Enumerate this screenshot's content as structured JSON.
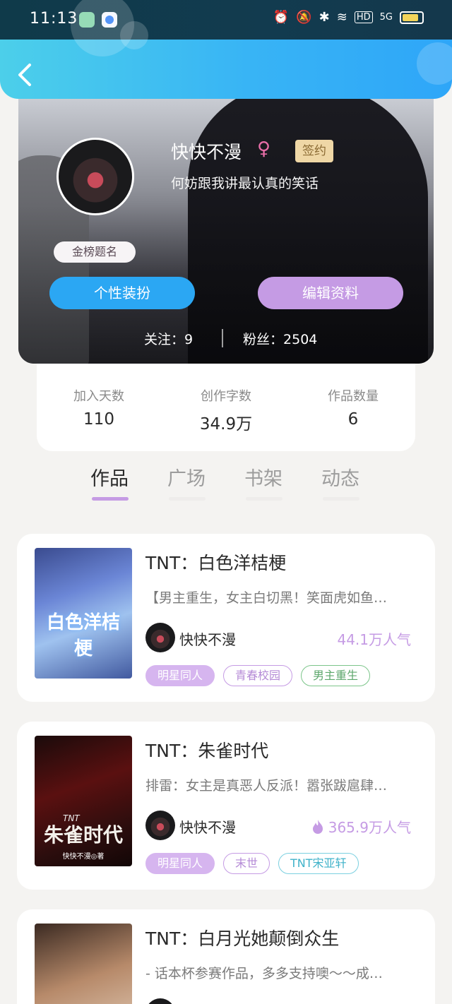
{
  "status_bar": {
    "time": "11:13",
    "icons": [
      "alarm-icon",
      "mute-icon",
      "bluetooth-icon",
      "wifi-icon",
      "hd-icon",
      "signal-5g-icon",
      "battery-icon"
    ],
    "hd_label": "HD",
    "net_label": "5G",
    "battery_level": 0.85
  },
  "header": {
    "back_icon": "back-arrow-icon"
  },
  "profile": {
    "username": "快快不漫",
    "gender_symbol": "♀",
    "sign_badge": "签约",
    "bio": "何妨跟我讲最认真的笑话",
    "rank_badge": "金榜题名",
    "dress_button": "个性装扮",
    "edit_button": "编辑资料",
    "follow_label": "关注：",
    "follow_count": "9",
    "fans_label": "粉丝：",
    "fans_count": "2504"
  },
  "stats": [
    {
      "label": "加入天数",
      "value": "110"
    },
    {
      "label": "创作字数",
      "value": "34.9万"
    },
    {
      "label": "作品数量",
      "value": "6"
    }
  ],
  "tabs": [
    {
      "label": "作品",
      "active": true
    },
    {
      "label": "广场",
      "active": false
    },
    {
      "label": "书架",
      "active": false
    },
    {
      "label": "动态",
      "active": false
    }
  ],
  "works": [
    {
      "title": "TNT：白色洋桔梗",
      "cover_text": "白色洋桔梗",
      "description": "【男主重生，女主白切黑！笑面虎如鱼…",
      "author": "快快不漫",
      "popularity": "44.1万人气",
      "show_flame": false,
      "tags": [
        {
          "label": "明星同人",
          "style": "fill"
        },
        {
          "label": "青春校园",
          "style": "purple"
        },
        {
          "label": "男主重生",
          "style": "green"
        }
      ]
    },
    {
      "title": "TNT：朱雀时代",
      "cover_text": "朱雀时代",
      "cover_small": "TNT",
      "cover_author": "快快不漫◎著",
      "description": "排雷：女主是真恶人反派！嚣张跋扈肆…",
      "author": "快快不漫",
      "popularity": "365.9万人气",
      "show_flame": true,
      "tags": [
        {
          "label": "明星同人",
          "style": "fill"
        },
        {
          "label": "末世",
          "style": "purple"
        },
        {
          "label": "TNT宋亚轩",
          "style": "teal"
        }
      ]
    },
    {
      "title": "TNT：白月光她颠倒众生",
      "description": "- 话本杯参赛作品，多多支持噢～～成…"
    }
  ],
  "colors": {
    "accent_blue": "#2ba7f3",
    "accent_purple": "#c59be4",
    "tab_underline": "#c59be4",
    "background": "#f4f3f1"
  }
}
